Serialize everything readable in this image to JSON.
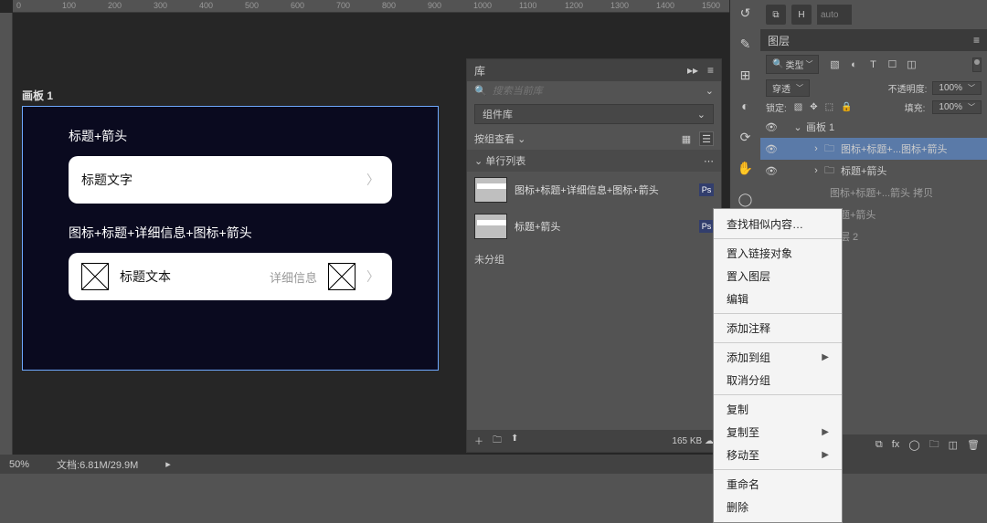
{
  "ruler_h": [
    "0",
    "100",
    "200",
    "300",
    "400",
    "500",
    "600",
    "700",
    "800",
    "900",
    "1000",
    "1100",
    "1200",
    "1300",
    "1400",
    "1500"
  ],
  "canvas": {
    "artboard_label": "画板 1",
    "section1_label": "标题+箭头",
    "section1_title": "标题文字",
    "section2_label": "图标+标题+详细信息+图标+箭头",
    "section2_title": "标题文本",
    "section2_detail": "详细信息"
  },
  "library": {
    "tab": "库",
    "collapse": "▸▸",
    "menu": "≡",
    "search_placeholder": "搜索当前库",
    "lib_dropdown": "组件库",
    "view_label": "按组查看",
    "group1": "单行列表",
    "item1": "图标+标题+详细信息+图标+箭头",
    "item2": "标题+箭头",
    "ungrouped": "未分组",
    "badge": "Ps",
    "size": "165 KB"
  },
  "panels": {
    "auto_h": "H",
    "auto_val": "auto",
    "layers_tab": "图层",
    "filter_label": "类型",
    "blend_label": "穿透",
    "opacity_label": "不透明度:",
    "opacity_val": "100%",
    "lock_label": "锁定:",
    "fill_label": "填充:",
    "fill_val": "100%"
  },
  "layers": {
    "artboard": "画板 1",
    "g1": "图标+标题+...图标+箭头",
    "g2": "标题+箭头",
    "g3_partial": "图标+标题+...箭头 拷贝",
    "g4_partial": "标题+箭头",
    "g5_partial": "图层 2"
  },
  "context_menu": {
    "find_similar": "查找相似内容…",
    "place_linked": "置入链接对象",
    "place_layer": "置入图层",
    "edit": "编辑",
    "add_note": "添加注释",
    "add_to_group": "添加到组",
    "ungroup": "取消分组",
    "copy": "复制",
    "copy_to": "复制至",
    "move_to": "移动至",
    "rename": "重命名",
    "delete": "删除"
  },
  "status": {
    "zoom": "50%",
    "doc": "文档:6.81M/29.9M"
  }
}
